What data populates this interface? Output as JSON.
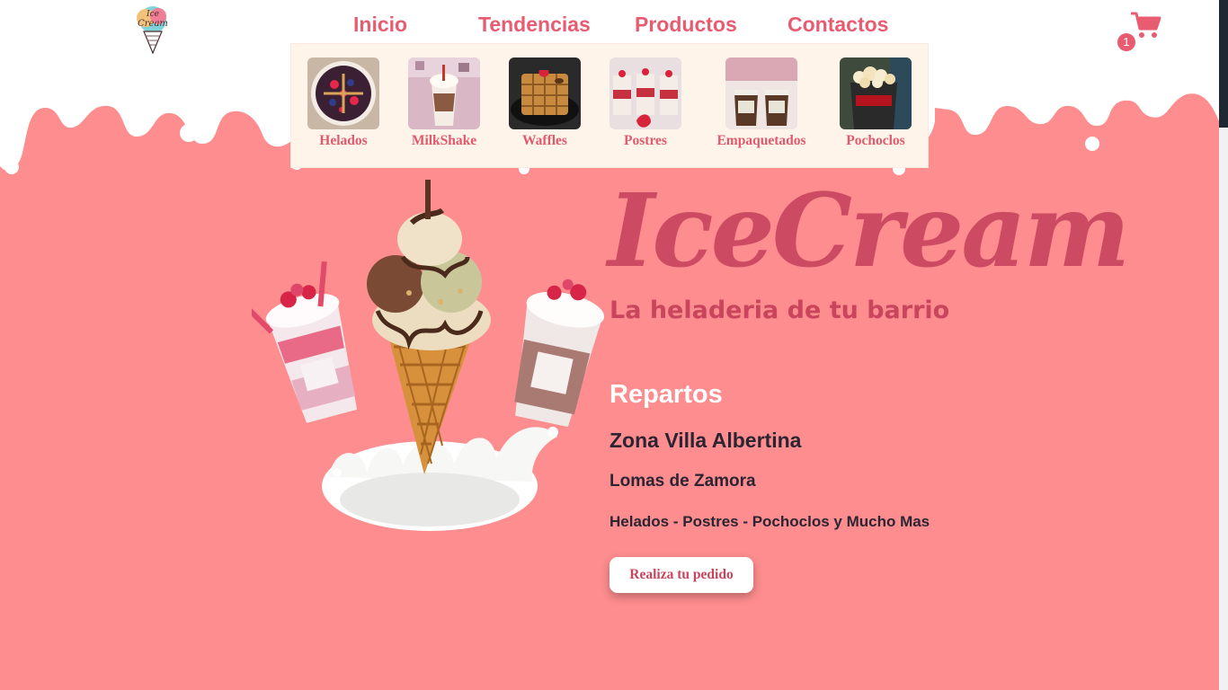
{
  "nav": {
    "links": [
      "Inicio",
      "Tendencias",
      "Productos",
      "Contactos"
    ]
  },
  "cart": {
    "count": "1"
  },
  "dropdown": {
    "items": [
      {
        "label": "Helados"
      },
      {
        "label": "MilkShake"
      },
      {
        "label": "Waffles"
      },
      {
        "label": "Postres"
      },
      {
        "label": "Empaquetados"
      },
      {
        "label": "Pochoclos"
      }
    ]
  },
  "hero": {
    "title": "IceCream",
    "subtitle": "La heladeria de tu barrio",
    "section_title": "Repartos",
    "zone": "Zona Villa Albertina",
    "locality": "Lomas de Zamora",
    "products": "Helados - Postres - Pochoclos y Mucho Mas",
    "cta_label": "Realiza tu pedido"
  },
  "colors": {
    "background": "#fd8d8e",
    "accent": "#e85c72",
    "title": "#cc4a62",
    "dropdown_bg": "#fff4ea"
  }
}
